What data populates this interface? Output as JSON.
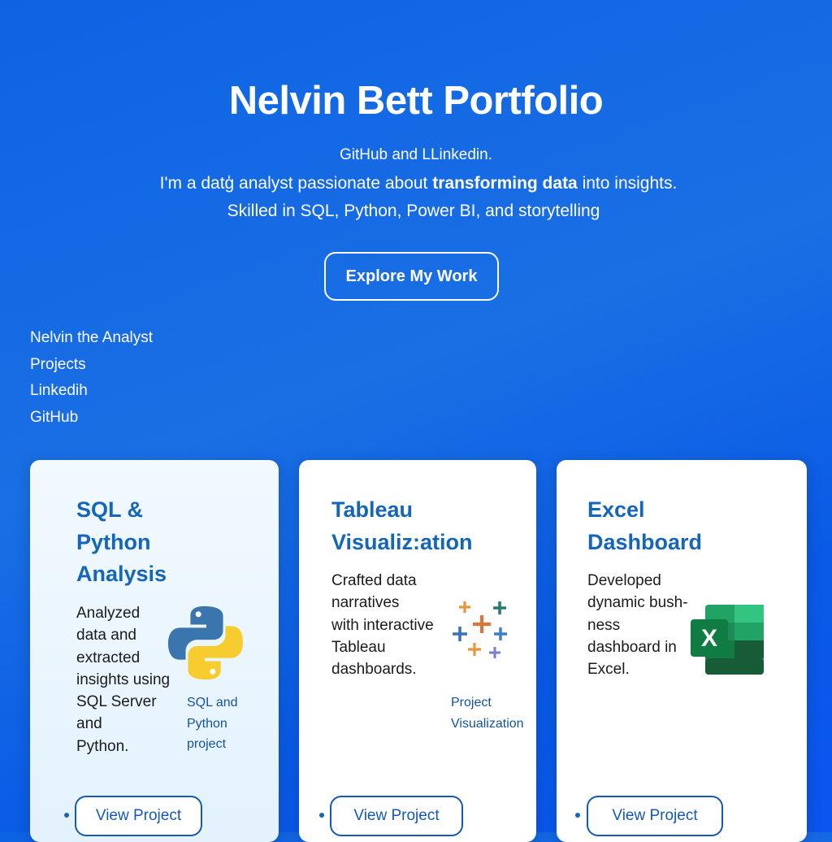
{
  "hero": {
    "title": "Nelvin Bett Portfolio",
    "line1": "GitHub and LLinkedin.",
    "line2_pre": "I'm a datģ analyst passionate about ",
    "line2_bold": "transforming data",
    "line2_post": "  into insights.",
    "line3": "Skilled in SQL, Python, Power BI, and storytelling",
    "cta_label": "Explore My Work"
  },
  "nav": {
    "items": [
      "Nelvin the Analyst",
      "Projects",
      "Linkedih",
      "GitHub"
    ]
  },
  "cards": [
    {
      "title_lines": [
        "SQL &",
        "Python",
        "Analysis"
      ],
      "desc_lines": [
        "Analyzed",
        "data and",
        "extracted",
        "insights using",
        "SQL Server",
        "and",
        "Python."
      ],
      "caption_lines": [
        "SQL and",
        "Python",
        "project"
      ],
      "icon": "python-logo-icon",
      "button": "View Project"
    },
    {
      "title_lines": [
        "Tableau",
        "Visualiz:ation"
      ],
      "desc_lines": [
        "Crafted data",
        "narratives",
        "with interactive",
        "Tableau",
        "dashboards."
      ],
      "caption_lines": [
        "Project",
        "Visualization"
      ],
      "icon": "tableau-logo-icon",
      "button": "View Project"
    },
    {
      "title_lines": [
        "Excel",
        "Dashboard"
      ],
      "desc_lines": [
        "Developed",
        "dynamic bush-",
        "ness",
        "dashboard in",
        "Excel."
      ],
      "icon": "excel-logo-icon",
      "icon_letter": "X",
      "button": "View Project"
    }
  ],
  "colors": {
    "background": "#0e63e3",
    "card_title": "#1565b8",
    "button_border": "#1559b0"
  }
}
